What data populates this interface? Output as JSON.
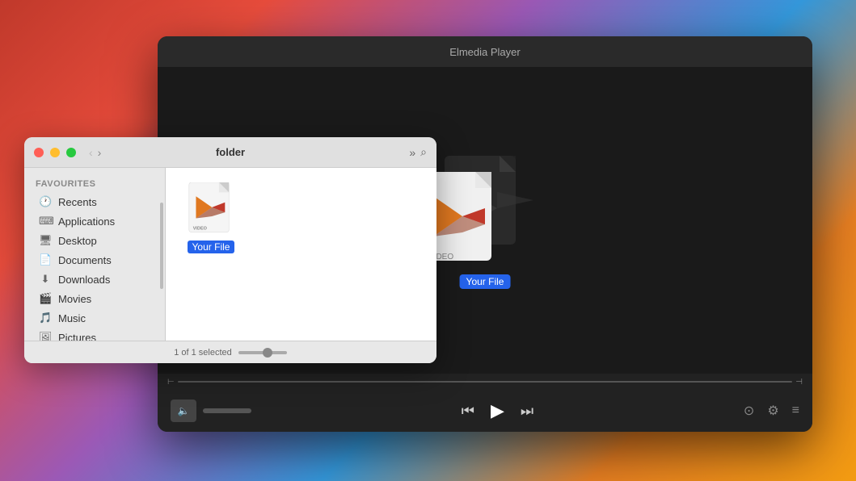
{
  "player": {
    "title": "Elmedia Player",
    "file_label": "Your File",
    "controls": {
      "prev_label": "⏮",
      "play_label": "▶",
      "next_label": "⏭",
      "volume_icon": "🔈",
      "airplay_icon": "⊙",
      "settings_icon": "⚙",
      "playlist_icon": "≡"
    }
  },
  "finder": {
    "title": "folder",
    "status": "1 of 1 selected",
    "file": {
      "name": "Your File",
      "type": "VIDEO"
    },
    "sidebar": {
      "section_label": "Favourites",
      "items": [
        {
          "id": "recents",
          "icon": "🕐",
          "label": "Recents"
        },
        {
          "id": "applications",
          "icon": "⌨",
          "label": "Applications"
        },
        {
          "id": "desktop",
          "icon": "🖥",
          "label": "Desktop"
        },
        {
          "id": "documents",
          "icon": "📄",
          "label": "Documents"
        },
        {
          "id": "downloads",
          "icon": "⬇",
          "label": "Downloads"
        },
        {
          "id": "movies",
          "icon": "🎬",
          "label": "Movies"
        },
        {
          "id": "music",
          "icon": "🎵",
          "label": "Music"
        },
        {
          "id": "pictures",
          "icon": "🖼",
          "label": "Pictures"
        }
      ]
    }
  }
}
